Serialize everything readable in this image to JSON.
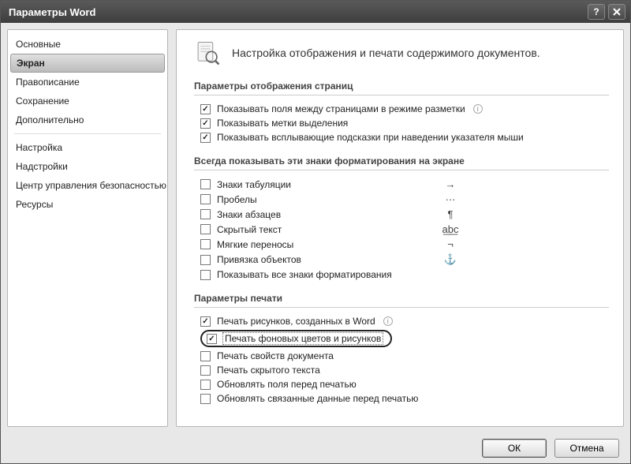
{
  "window": {
    "title": "Параметры Word"
  },
  "sidebar": {
    "items": [
      {
        "label": "Основные"
      },
      {
        "label": "Экран",
        "selected": true
      },
      {
        "label": "Правописание"
      },
      {
        "label": "Сохранение"
      },
      {
        "label": "Дополнительно"
      },
      {
        "divider": true
      },
      {
        "label": "Настройка"
      },
      {
        "label": "Надстройки"
      },
      {
        "label": "Центр управления безопасностью"
      },
      {
        "label": "Ресурсы"
      }
    ]
  },
  "heading": "Настройка отображения и печати содержимого документов.",
  "section1": {
    "title": "Параметры отображения страниц",
    "items": [
      {
        "label": "Показывать поля между страницами в режиме разметки",
        "checked": true,
        "info": true
      },
      {
        "label": "Показывать метки выделения",
        "checked": true
      },
      {
        "label": "Показывать всплывающие подсказки при наведении указателя мыши",
        "checked": true
      }
    ]
  },
  "section2": {
    "title": "Всегда показывать эти знаки форматирования на экране",
    "items": [
      {
        "label": "Знаки табуляции",
        "checked": false,
        "symbol": "→"
      },
      {
        "label": "Пробелы",
        "checked": false,
        "symbol": "···"
      },
      {
        "label": "Знаки абзацев",
        "checked": false,
        "symbol": "¶"
      },
      {
        "label": "Скрытый текст",
        "checked": false,
        "symbol": "a͟b͟c"
      },
      {
        "label": "Мягкие переносы",
        "checked": false,
        "symbol": "¬"
      },
      {
        "label": "Привязка объектов",
        "checked": false,
        "symbol": "⚓"
      },
      {
        "label": "Показывать все знаки форматирования",
        "checked": false,
        "symbol": ""
      }
    ]
  },
  "section3": {
    "title": "Параметры печати",
    "items": [
      {
        "label": "Печать рисунков, созданных в Word",
        "checked": true,
        "info": true
      },
      {
        "label": "Печать фоновых цветов и рисунков",
        "checked": true,
        "highlight": true
      },
      {
        "label": "Печать свойств документа",
        "checked": false
      },
      {
        "label": "Печать скрытого текста",
        "checked": false
      },
      {
        "label": "Обновлять поля перед печатью",
        "checked": false
      },
      {
        "label": "Обновлять связанные данные перед печатью",
        "checked": false
      }
    ]
  },
  "buttons": {
    "ok": "ОК",
    "cancel": "Отмена"
  }
}
